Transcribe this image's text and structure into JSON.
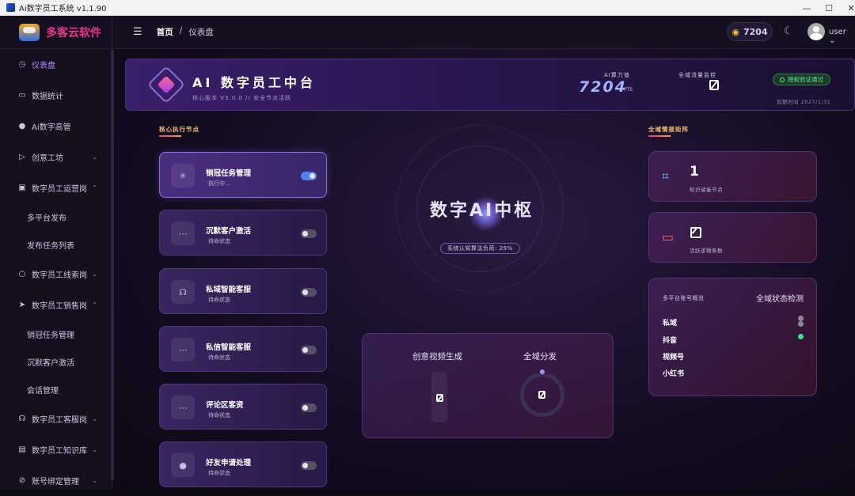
{
  "window": {
    "title": "Ai数字员工系统 v1.1.90",
    "min": "—",
    "max": "☐",
    "close": "✕"
  },
  "topbar": {
    "brand": "多客云软件",
    "menu_icon": "☰",
    "breadcrumb": [
      "首页",
      "/",
      "仪表盘"
    ],
    "points": "7204",
    "user": "user",
    "user_chevron": "⌄"
  },
  "sidebar": {
    "items": [
      {
        "label": "仪表盘",
        "icon": "dashboard-icon",
        "glyph": "◷",
        "active": true,
        "chevron": ""
      },
      {
        "label": "数据统计",
        "icon": "chart-icon",
        "glyph": "▭",
        "chevron": ""
      },
      {
        "label": "Ai数字高管",
        "icon": "person-icon",
        "glyph": "●",
        "chevron": ""
      },
      {
        "label": "创意工坊",
        "icon": "video-icon",
        "glyph": "▷",
        "chevron": "⌄"
      },
      {
        "label": "数字员工运营岗",
        "icon": "camera-icon",
        "glyph": "▣",
        "chevron": "⌃"
      }
    ],
    "ops_sub": [
      "多平台发布",
      "发布任务列表"
    ],
    "items2": [
      {
        "label": "数字员工线索岗",
        "icon": "search-icon",
        "glyph": "○",
        "chevron": "⌄"
      },
      {
        "label": "数字员工销售岗",
        "icon": "send-icon",
        "glyph": "➤",
        "chevron": "⌃"
      }
    ],
    "sales_sub": [
      "销冠任务管理",
      "沉默客户激活",
      "会话管理"
    ],
    "items3": [
      {
        "label": "数字员工客服岗",
        "icon": "headset-icon",
        "glyph": "☊",
        "chevron": "⌄"
      },
      {
        "label": "数字员工知识库",
        "icon": "book-icon",
        "glyph": "▤",
        "chevron": "⌄"
      },
      {
        "label": "账号绑定管理",
        "icon": "link-icon",
        "glyph": "⊘",
        "chevron": "⌄"
      }
    ]
  },
  "hero": {
    "title": "AI 数字员工中台",
    "subtitle": "核心版本 V3.0.0 // 安全节点活跃",
    "power_label": "AI算力值",
    "power_value": "7204",
    "power_unit": "PTS",
    "traffic_label": "全域流量监控",
    "auth_badge": "授权验证通过",
    "expire": "到期时间 2027/1/31"
  },
  "nodes_section": "核心执行节点",
  "nodes": [
    {
      "name": "销冠任务管理",
      "status": "执行中...",
      "icon": "spinner-icon",
      "glyph": "✳",
      "on": true
    },
    {
      "name": "沉默客户激活",
      "status": "待命状态",
      "icon": "chat-icon",
      "glyph": "⋯",
      "on": false
    },
    {
      "name": "私域智能客服",
      "status": "待命状态",
      "icon": "headset-icon",
      "glyph": "☊",
      "on": false
    },
    {
      "name": "私信智能客服",
      "status": "待命状态",
      "icon": "message-icon",
      "glyph": "⋯",
      "on": false
    },
    {
      "name": "评论区客资",
      "status": "待命状态",
      "icon": "comment-icon",
      "glyph": "⋯",
      "on": false
    },
    {
      "name": "好友申请处理",
      "status": "待命状态",
      "icon": "user-icon",
      "glyph": "●",
      "on": false
    }
  ],
  "core": {
    "title": "数字AI中枢",
    "load": "系统认知算法负荷: 29%"
  },
  "bottom_panel": {
    "video_label": "创意视频生成",
    "dist_label": "全域分发"
  },
  "matrix_section": "全域情报矩阵",
  "stats": [
    {
      "value": "1",
      "label": "知识储备节点",
      "icon": "cpu-icon",
      "glyph": "⌗",
      "color": "#5fd0ff"
    },
    {
      "label": "活跃逻辑条数",
      "icon": "monitor-icon",
      "glyph": "▭",
      "color": "#ff6a6a"
    }
  ],
  "platforms": {
    "header": "多平台账号概览",
    "check": "全域状态检测",
    "rows": [
      "私域",
      "抖音",
      "视频号",
      "小红书"
    ]
  }
}
